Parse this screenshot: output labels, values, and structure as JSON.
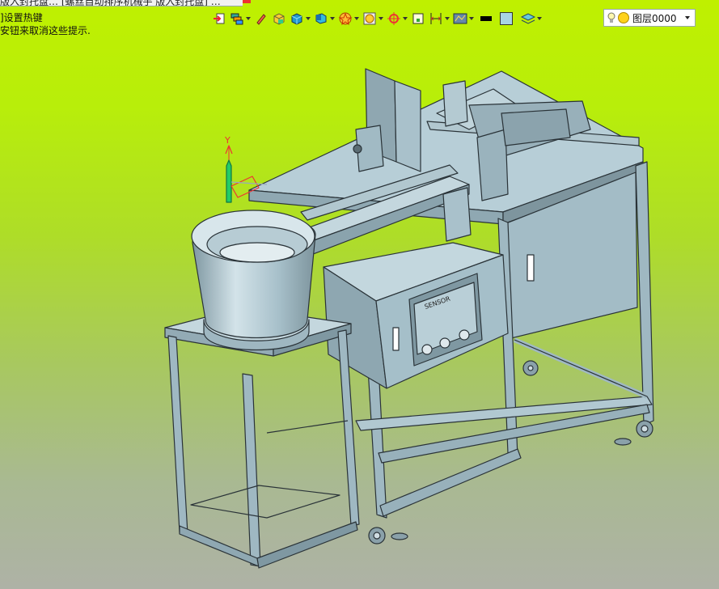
{
  "tab": {
    "title": "版入封托盘…  [螺丝自动排序机械手 版入封托盘] …"
  },
  "hints": {
    "line1": "]设置热键",
    "line2": "安钮来取消这些提示."
  },
  "toolbar": {
    "buttons": [
      {
        "name": "import-icon",
        "has_menu": false
      },
      {
        "name": "layers-stack-icon",
        "has_menu": true
      },
      {
        "name": "pencil-icon",
        "has_menu": false
      },
      {
        "name": "solid-cube-icon",
        "has_menu": false
      },
      {
        "name": "box-view-icon",
        "has_menu": true
      },
      {
        "name": "iso-view-icon",
        "has_menu": true
      },
      {
        "name": "star-render-icon",
        "has_menu": true
      },
      {
        "name": "material-icon",
        "has_menu": true
      },
      {
        "name": "snap-icon",
        "has_menu": true
      },
      {
        "name": "frame-icon",
        "has_menu": false
      },
      {
        "name": "dimension-icon",
        "has_menu": true
      },
      {
        "name": "display-mode-icon",
        "has_menu": true
      }
    ],
    "line_color": "#000000",
    "fill_color": "#a8d4e6",
    "layer_style_icon": "layers-icon"
  },
  "layer": {
    "name": "图层0000"
  },
  "axis": {
    "y_label": "Y"
  },
  "colors": {
    "bg_top": "#bff000",
    "bg_bottom": "#aeb2a6",
    "model_fill": "#a9c2cc",
    "model_dark": "#7e959e",
    "model_edge": "#2a3338"
  },
  "panel": {
    "label": "SENSOR"
  }
}
